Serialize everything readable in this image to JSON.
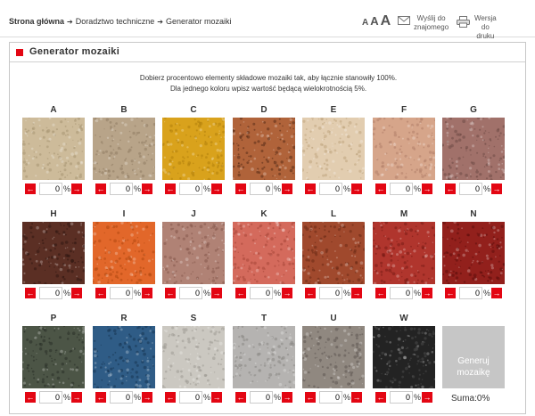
{
  "breadcrumb": {
    "home": "Strona główna",
    "section": "Doradztwo techniczne",
    "current": "Generator mozaiki"
  },
  "font_sizes": [
    "A",
    "A",
    "A"
  ],
  "tools": {
    "send_label": "Wyślij do\nznajomego",
    "print_label": "Wersja\ndo druku"
  },
  "panel": {
    "title": "Generator mozaiki",
    "intro_line1": "Dobierz procentowo elementy składowe mozaiki tak, aby łącznie stanowiły 100%.",
    "intro_line2": "Dla jednego koloru wpisz wartość będącą wielokrotnością 5%."
  },
  "colors": {
    "accent": "#e30613",
    "button_disabled": "#c6c6c6"
  },
  "mosaics": [
    {
      "label": "A",
      "value": "0",
      "unit": "%",
      "color": "#cdbb9a",
      "dot": "#a89573"
    },
    {
      "label": "B",
      "value": "0",
      "unit": "%",
      "color": "#b8a489",
      "dot": "#8f7b62"
    },
    {
      "label": "C",
      "value": "0",
      "unit": "%",
      "color": "#d9a21c",
      "dot": "#b07f0c"
    },
    {
      "label": "D",
      "value": "0",
      "unit": "%",
      "color": "#b0633a",
      "dot": "#5a2e18"
    },
    {
      "label": "E",
      "value": "0",
      "unit": "%",
      "color": "#e2cdb0",
      "dot": "#bfa580"
    },
    {
      "label": "F",
      "value": "0",
      "unit": "%",
      "color": "#d6a58a",
      "dot": "#b2806a"
    },
    {
      "label": "G",
      "value": "0",
      "unit": "%",
      "color": "#a1716a",
      "dot": "#6f4a45"
    },
    {
      "label": "H",
      "value": "0",
      "unit": "%",
      "color": "#5b2f24",
      "dot": "#321812"
    },
    {
      "label": "I",
      "value": "0",
      "unit": "%",
      "color": "#e2672a",
      "dot": "#b04810"
    },
    {
      "label": "J",
      "value": "0",
      "unit": "%",
      "color": "#b08275",
      "dot": "#86594d"
    },
    {
      "label": "K",
      "value": "0",
      "unit": "%",
      "color": "#d46a5c",
      "dot": "#a64539"
    },
    {
      "label": "L",
      "value": "0",
      "unit": "%",
      "color": "#a0492d",
      "dot": "#6b2a15"
    },
    {
      "label": "M",
      "value": "0",
      "unit": "%",
      "color": "#b0352d",
      "dot": "#7a1c16"
    },
    {
      "label": "N",
      "value": "0",
      "unit": "%",
      "color": "#92201c",
      "dot": "#5e0f0c"
    },
    {
      "label": "P",
      "value": "0",
      "unit": "%",
      "color": "#4c5546",
      "dot": "#2a3028"
    },
    {
      "label": "R",
      "value": "0",
      "unit": "%",
      "color": "#2f5c86",
      "dot": "#173654"
    },
    {
      "label": "S",
      "value": "0",
      "unit": "%",
      "color": "#cbc8c1",
      "dot": "#9f9b94"
    },
    {
      "label": "T",
      "value": "0",
      "unit": "%",
      "color": "#b5b3b1",
      "dot": "#888684"
    },
    {
      "label": "U",
      "value": "0",
      "unit": "%",
      "color": "#908880",
      "dot": "#5f5852"
    },
    {
      "label": "W",
      "value": "0",
      "unit": "%",
      "color": "#232323",
      "dot": "#4a4a4a"
    }
  ],
  "generate_label": "Generuj mozaikę",
  "suma": {
    "label": "Suma:",
    "value": "0%"
  }
}
